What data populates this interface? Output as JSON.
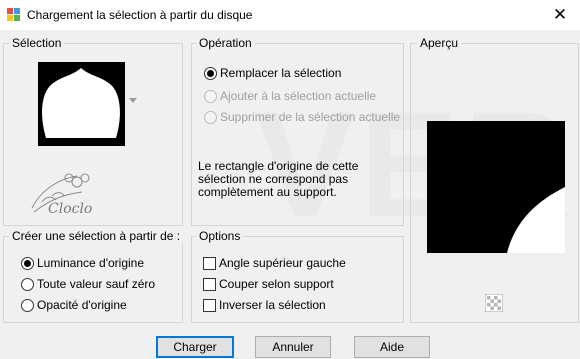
{
  "window": {
    "title": "Chargement la sélection à partir du disque",
    "close_glyph": "✕"
  },
  "watermark": {
    "text": "VER",
    "tube_text": "Cloclo"
  },
  "selection_panel": {
    "title": "Sélection"
  },
  "operation_panel": {
    "title": "Opération",
    "options": [
      {
        "label": "Remplacer la sélection",
        "checked": true,
        "disabled": false
      },
      {
        "label": "Ajouter à la sélection actuelle",
        "checked": false,
        "disabled": true
      },
      {
        "label": "Supprimer de la sélection actuelle",
        "checked": false,
        "disabled": true
      }
    ],
    "note": "Le rectangle d'origine de cette sélection ne correspond pas complètement au support."
  },
  "preview_panel": {
    "title": "Aperçu"
  },
  "create_panel": {
    "title": "Créer une sélection à partir de :",
    "options": [
      {
        "label": "Luminance d'origine",
        "checked": true
      },
      {
        "label": "Toute valeur sauf zéro",
        "checked": false
      },
      {
        "label": "Opacité d'origine",
        "checked": false
      }
    ]
  },
  "options_panel": {
    "title": "Options",
    "checkboxes": [
      {
        "label": "Angle supérieur gauche",
        "checked": false
      },
      {
        "label": "Couper selon support",
        "checked": false
      },
      {
        "label": "Inverser la sélection",
        "checked": false
      }
    ]
  },
  "buttons": {
    "load": "Charger",
    "cancel": "Annuler",
    "help": "Aide"
  },
  "colors": {
    "accent": "#0078d7",
    "panel_border": "#d5d5d5",
    "background": "#f0f0f0"
  }
}
